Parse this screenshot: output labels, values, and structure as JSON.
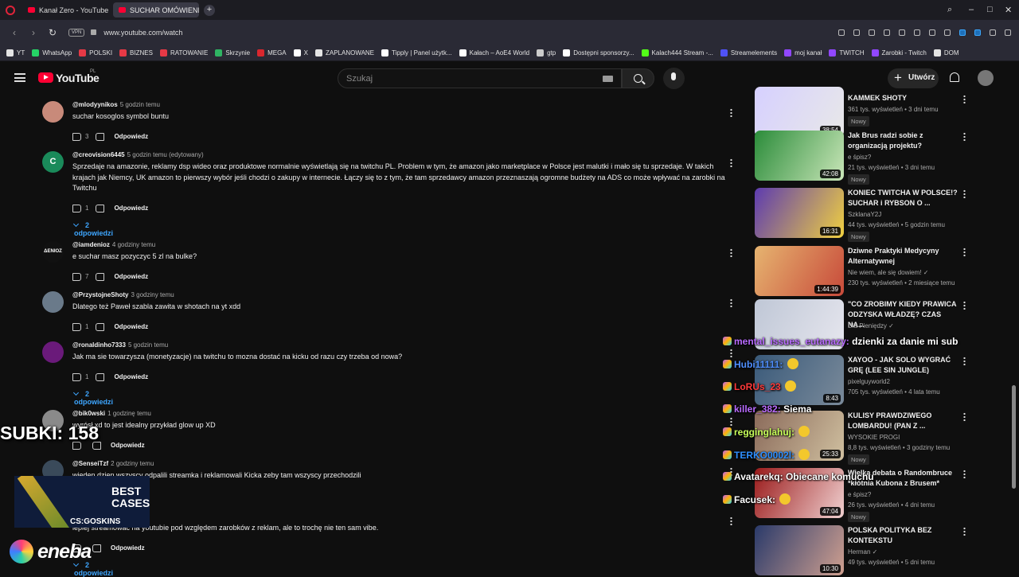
{
  "browser": {
    "tabs": [
      {
        "label": "Kanał Zero - YouTube"
      },
      {
        "label": "SUCHAR OMÓWIENIE SP..."
      }
    ],
    "new_tab": "+",
    "url": "www.youtube.com/watch",
    "vpn": "VPN",
    "bookmarks": [
      "YT",
      "WhatsApp",
      "POLSKI",
      "BIZNES",
      "RATOWANIE",
      "Skrzynie",
      "MEGA",
      "X",
      "ZAPLANOWANE",
      "Tipply | Panel użytk...",
      "Kałach – AoE4 World",
      "gtp",
      "Dostępni sponsorzy...",
      "Kalach444 Stream -...",
      "Streamelements",
      "moj kanał",
      "TWITCH",
      "Zarobki - Twitch",
      "DOM"
    ],
    "bookmark_colors": [
      "#e4e4e4",
      "#25d366",
      "#e63946",
      "#e63946",
      "#e63946",
      "#2fb463",
      "#d9272e",
      "#ffffff",
      "#e4e4e4",
      "#ffffff",
      "#ffffff",
      "#cccccc",
      "#ffffff",
      "#53fc18",
      "#4f52f6",
      "#9147ff",
      "#9147ff",
      "#9147ff",
      "#e4e4e4"
    ]
  },
  "youtube": {
    "logo_text": "YouTube",
    "region": "PL",
    "search_placeholder": "Szukaj",
    "create_label": "Utwórz"
  },
  "comments": [
    {
      "author": "@mlodyynikos",
      "time": "5 godzin temu",
      "text": "suchar kosoglos symbol buntu",
      "likes": "3",
      "reply": "Odpowiedz",
      "replies": ""
    },
    {
      "author": "@creovision6445",
      "time": "5 godzin temu (edytowany)",
      "text": "Sprzedaje na amazonie, reklamy dsp wideo oraz produktowe normalnie wyświetlają się na twitchu PL. Problem w tym, że amazon jako marketplace w Polsce jest malutki i mało się tu sprzedaje. W takich krajach jak Niemcy, UK amazon to pierwszy wybór jeśli chodzi o zakupy w internecie. Łączy się to z tym, że tam sprzedawcy amazon przeznaszają ogromne budżety na ADS co może wpływać na zarobki na Twitchu",
      "likes": "1",
      "reply": "Odpowiedz",
      "replies": "2 odpowiedzi",
      "avatar_letter": "C"
    },
    {
      "author": "@iamdenioz",
      "time": "4 godziny temu",
      "text": "e suchar masz pozyczyc 5 zl na bulke?",
      "likes": "7",
      "reply": "Odpowiedz",
      "replies": "",
      "avatar_letter": "ΔENIOZ"
    },
    {
      "author": "@PrzystojneShoty",
      "time": "3 godziny temu",
      "text": "Dlatego też Paweł szabla zawita w shotach na yt xdd",
      "likes": "1",
      "reply": "Odpowiedz",
      "replies": ""
    },
    {
      "author": "@ronaldinho7333",
      "time": "5 godzin temu",
      "text": "Jak ma sie towarzysza (monetyzacje) na twitchu to mozna dostać na kicku od razu czy trzeba od nowa?",
      "likes": "1",
      "reply": "Odpowiedz",
      "replies": "2 odpowiedzi"
    },
    {
      "author": "@bik0wski",
      "time": "1 godzinę temu",
      "text": "wyrósł xd to jest idealny przykład glow up XD",
      "likes": "",
      "reply": "Odpowiedz",
      "replies": ""
    },
    {
      "author": "@SenseiTzf",
      "time": "2 godziny temu",
      "text": "wjeden dzien wszyscy odpalili streamka i reklamowali Kicka zeby tam wszyscy przechodzili",
      "likes": "",
      "reply": "",
      "replies": ""
    },
    {
      "author": "",
      "time": "",
      "text": "lepiej streamować na youtubie pod względem zarobków z reklam, ale to trochę nie ten sam vibe.",
      "likes": "",
      "reply": "Odpowiedz",
      "replies": "2 odpowiedzi"
    }
  ],
  "sidebar_videos": [
    {
      "title": "KAMMEK SHOTY",
      "title2": "",
      "channel": "",
      "meta": "361 tys. wyświetleń • 3 dni temu",
      "new": "Nowy",
      "duration": "38:54",
      "colors": [
        "#d6d0ff",
        "#e8e8e8"
      ]
    },
    {
      "title": "Jak Brus radzi sobie z",
      "title2": "organizacją projektu?",
      "channel": "e śpisz?",
      "meta": "21 tys. wyświetleń • 3 dni temu",
      "new": "Nowy",
      "duration": "42:08",
      "colors": [
        "#2b8c3a",
        "#c9e6b8"
      ]
    },
    {
      "title": "KONIEC TWITCHA W POLSCE!?",
      "title2": "SUCHAR i RYBSON O ...",
      "channel": "SzklanaY2J",
      "meta": "44 tys. wyświetleń • 5 godzin temu",
      "new": "Nowy",
      "duration": "16:31",
      "colors": [
        "#5d3bb0",
        "#f0d040"
      ]
    },
    {
      "title": "Dziwne Praktyki Medycyny",
      "title2": "Alternatywnej",
      "channel": "Nie wiem, ale się dowiem! ✓",
      "meta": "230 tys. wyświetleń • 2 miesiące temu",
      "new": "",
      "duration": "1:44:39",
      "colors": [
        "#e6b470",
        "#c84a3a"
      ]
    },
    {
      "title": "\"CO ZROBIMY KIEDY PRAWICA",
      "title2": "ODZYSKA WŁADZĘ? CZAS NA...",
      "channel": "Dla Pieniędzy ✓",
      "meta": "",
      "new": "",
      "duration": "",
      "colors": [
        "#bfc7d6",
        "#e6e6ee"
      ]
    },
    {
      "title": "XAYOO - JAK SOLO WYGRAĆ",
      "title2": "GRĘ (LEE SIN JUNGLE)",
      "channel": "pixelguyworld2",
      "meta": "705 tys. wyświetleń • 4 lata temu",
      "new": "",
      "duration": "8:43",
      "colors": [
        "#3a5a7a",
        "#7a8a9a"
      ]
    },
    {
      "title": "KULISY PRAWDZIWEGO",
      "title2": "LOMBARDU! (PAN Z ...",
      "channel": "WYSOKIE PROGI",
      "meta": "8,8 tys. wyświetleń • 3 godziny temu",
      "new": "Nowy",
      "duration": "25:33",
      "colors": [
        "#8a6a5a",
        "#d0c0a0"
      ]
    },
    {
      "title": "Wielka debata o Randombruce",
      "title2": "*kłótnia Kubona z Brusem*",
      "channel": "e śpisz?",
      "meta": "26 tys. wyświetleń • 4 dni temu",
      "new": "Nowy",
      "duration": "47:04",
      "colors": [
        "#9a1a1a",
        "#f0d0d0"
      ]
    },
    {
      "title": "POLSKA POLITYKA BEZ",
      "title2": "KONTEKSTU",
      "channel": "Herman ✓",
      "meta": "49 tys. wyświetleń • 5 dni temu",
      "new": "",
      "duration": "10:30",
      "colors": [
        "#2a3a6a",
        "#d0a090"
      ]
    }
  ],
  "stream_overlay": {
    "subs_label": "SUBKI: 158",
    "chat": [
      {
        "user": "mental_issues_eutanazy:",
        "msg": "dzienki za danie mi sub",
        "color": "#b96bff"
      },
      {
        "user": "Hubi11111:",
        "msg": "",
        "color": "#4f8fff"
      },
      {
        "user": "LoRUs_23",
        "msg": "",
        "color": "#ff3a3a"
      },
      {
        "user": "killer_382:",
        "msg": "Siema",
        "color": "#b96bff"
      },
      {
        "user": "regginglahuj:",
        "msg": "",
        "color": "#c8ff5a"
      },
      {
        "user": "TERKO0002l:",
        "msg": "",
        "color": "#2e8fff"
      },
      {
        "user": "Avatarekq:",
        "msg": "Obiecane komuchu",
        "color": "#ffffff"
      },
      {
        "user": "Facusek:",
        "msg": "",
        "color": "#ffffff"
      }
    ],
    "sponsor_best": "BEST",
    "sponsor_cases": "CASES",
    "sponsor_brand": "CS:GOSKINS",
    "eneba": "eneba"
  }
}
